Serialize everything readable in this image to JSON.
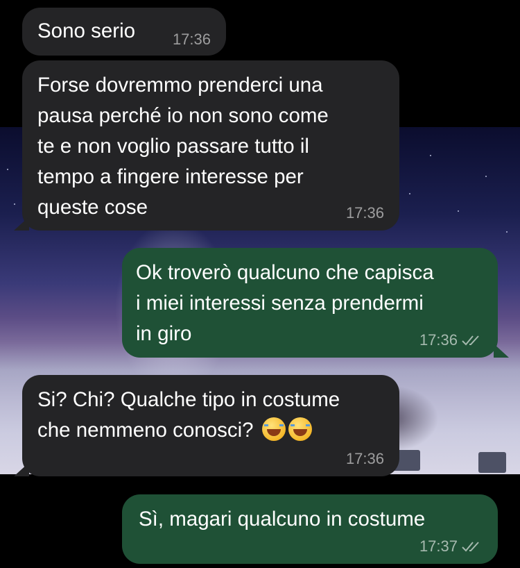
{
  "messages": [
    {
      "dir": "in",
      "text": "Sono serio",
      "time": "17:36"
    },
    {
      "dir": "in",
      "text": "Forse dovremmo prenderci una\npausa perché io non sono come\nte e non voglio passare tutto il\ntempo a fingere interesse per\nqueste cose",
      "time": "17:36"
    },
    {
      "dir": "out",
      "text": "Ok troverò qualcuno che capisca\ni miei interessi senza prendermi\nin giro",
      "time": "17:36",
      "status_icon": "double-check-icon"
    },
    {
      "dir": "in",
      "text": "Si? Chi? Qualche tipo in costume\nche nemmeno conosci?",
      "emoji": "😂😂",
      "emoji_icon": "face-with-tears-of-joy-icon",
      "time": "17:36"
    },
    {
      "dir": "out",
      "text": "Sì, magari qualcuno in costume",
      "time": "17:37",
      "status_icon": "double-check-icon"
    }
  ],
  "colors": {
    "incoming_bubble": "#242426",
    "outgoing_bubble": "#1f5136",
    "background": "#000000"
  }
}
